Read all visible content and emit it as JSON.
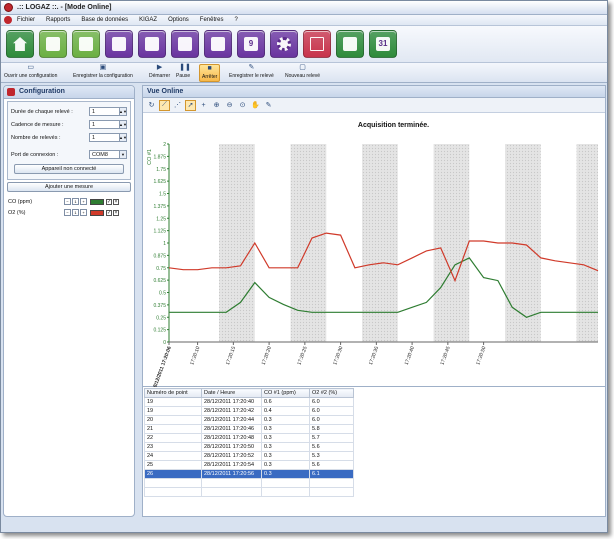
{
  "window": {
    "title": ".:: LOGAZ ::. - [Mode Online]"
  },
  "menu": [
    "Fichier",
    "Rapports",
    "Base de données",
    "KIGAZ",
    "Options",
    "Fenêtres",
    "?"
  ],
  "colors": {
    "bar_green": "#2e8b3b",
    "bar_purple": "#6a35a0",
    "series_co": "#2f7d32",
    "series_o2": "#d03a2a",
    "selected_row": "#3a6bc2"
  },
  "toolbar_big": [
    {
      "icon": "home-icon",
      "color": "#2e8b3b"
    },
    {
      "icon": "edit-sheet-icon",
      "color": "#6cb043"
    },
    {
      "icon": "sheet-add-icon",
      "color": "#6cb043"
    },
    {
      "icon": "chip-icon",
      "color": "#6a35a0"
    },
    {
      "icon": "user-icon",
      "color": "#6a35a0"
    },
    {
      "icon": "document-icon",
      "color": "#6a35a0"
    },
    {
      "icon": "folder-icon",
      "color": "#6a35a0"
    },
    {
      "icon": "calendar-icon",
      "color": "#6a35a0",
      "text": "9"
    },
    {
      "icon": "gear-icon",
      "color": "#6a35a0"
    },
    {
      "icon": "monitor-chart-icon",
      "color": "#c8344c"
    },
    {
      "icon": "export-icon",
      "color": "#2e8b3b"
    },
    {
      "icon": "calendar-31-icon",
      "color": "#2e8b3b",
      "text": "31"
    }
  ],
  "toolbar_small": [
    {
      "label": "Ouvrir une configuration",
      "icon": "open-icon"
    },
    {
      "label": "Enregistrer la configuration",
      "icon": "save-icon"
    },
    {
      "label": "Démarrer",
      "icon": "play-icon"
    },
    {
      "label": "Pause",
      "icon": "pause-icon"
    },
    {
      "label": "Arrêter",
      "icon": "stop-icon",
      "active": true
    },
    {
      "label": "Enregistrer le relevé",
      "icon": "save-record-icon"
    },
    {
      "label": "Nouveau relevé",
      "icon": "new-record-icon"
    }
  ],
  "config": {
    "title": "Configuration",
    "fields": [
      {
        "label": "Durée de chaque relevé :",
        "value": "1"
      },
      {
        "label": "Cadence de mesure :",
        "value": "1"
      },
      {
        "label": "Nombre de relevés :",
        "value": "1"
      }
    ],
    "port_label": "Port de connexion :",
    "port_value": "COM8",
    "device_button": "Appareil non connecté",
    "add_button": "Ajouter une mesure",
    "measures": [
      {
        "label": "CO (ppm)",
        "index": "1",
        "color": "#2f7d32"
      },
      {
        "label": "O2 (%)",
        "index": "1",
        "color": "#d03a2a"
      }
    ]
  },
  "vue": {
    "title": "Vue Online"
  },
  "chart_data": {
    "type": "line",
    "title": "Acquisition terminée.",
    "ylabel": "CO #1",
    "ylim": [
      0,
      2.0
    ],
    "yticks": [
      "0",
      "0.125",
      "0.25",
      "0.375",
      "0.5",
      "0.625",
      "0.75",
      "0.875",
      "1",
      "1.125",
      "1.25",
      "1.375",
      "1.5",
      "1.625",
      "1.75",
      "1.875",
      "2"
    ],
    "xlim": [
      0,
      60
    ],
    "xticks": [
      {
        "t": 0,
        "label": "28/12/2011 17:20:06"
      },
      {
        "t": 4,
        "label": "17:20:10"
      },
      {
        "t": 9,
        "label": "17:20:15"
      },
      {
        "t": 14,
        "label": "17:20:20"
      },
      {
        "t": 19,
        "label": "17:20:25"
      },
      {
        "t": 24,
        "label": "17:20:30"
      },
      {
        "t": 29,
        "label": "17:20:35"
      },
      {
        "t": 34,
        "label": "17:20:40"
      },
      {
        "t": 39,
        "label": "17:20:45"
      },
      {
        "t": 44,
        "label": "17:20:50"
      }
    ],
    "bands": [
      [
        7,
        12
      ],
      [
        17,
        22
      ],
      [
        27,
        32
      ],
      [
        37,
        42
      ],
      [
        47,
        52
      ],
      [
        57,
        60
      ]
    ],
    "series": [
      {
        "name": "CO #1 (ppm)",
        "color": "#2f7d32",
        "x": [
          0,
          2,
          4,
          6,
          8,
          10,
          12,
          14,
          16,
          18,
          20,
          22,
          24,
          26,
          28,
          30,
          32,
          34,
          36,
          38,
          40,
          42,
          44,
          46,
          48,
          50,
          52,
          54,
          56,
          58,
          60
        ],
        "y": [
          0.3,
          0.3,
          0.3,
          0.3,
          0.3,
          0.4,
          0.6,
          0.45,
          0.38,
          0.32,
          0.3,
          0.3,
          0.3,
          0.3,
          0.3,
          0.3,
          0.3,
          0.35,
          0.4,
          0.55,
          0.78,
          0.85,
          0.65,
          0.62,
          0.35,
          0.25,
          0.3,
          0.3,
          0.3,
          0.3,
          0.3
        ]
      },
      {
        "name": "O2 #2 (%)",
        "color": "#d03a2a",
        "x": [
          0,
          2,
          4,
          6,
          8,
          10,
          12,
          14,
          16,
          18,
          20,
          22,
          24,
          26,
          28,
          30,
          32,
          34,
          36,
          38,
          40,
          42,
          44,
          46,
          48,
          50,
          52,
          54,
          56,
          58,
          60
        ],
        "y": [
          0.75,
          0.73,
          0.73,
          0.75,
          0.75,
          0.77,
          1.0,
          0.75,
          0.75,
          0.75,
          1.05,
          1.1,
          1.08,
          0.75,
          0.78,
          0.8,
          0.78,
          0.85,
          0.92,
          0.95,
          0.62,
          1.02,
          1.02,
          1.0,
          1.0,
          0.98,
          0.85,
          0.82,
          0.8,
          0.78,
          0.72
        ]
      }
    ]
  },
  "table": {
    "headers": [
      "Numéro de point",
      "Date / Heure",
      "CO #1 (ppm)",
      "O2 #2 (%)"
    ],
    "rows": [
      [
        "19",
        "28/12/2011 17:20:40",
        "0.6",
        "6.0"
      ],
      [
        "19",
        "28/12/2011 17:20:42",
        "0.4",
        "6.0"
      ],
      [
        "20",
        "28/12/2011 17:20:44",
        "0.3",
        "6.0"
      ],
      [
        "21",
        "28/12/2011 17:20:46",
        "0.3",
        "5.8"
      ],
      [
        "22",
        "28/12/2011 17:20:48",
        "0.3",
        "5.7"
      ],
      [
        "23",
        "28/12/2011 17:20:50",
        "0.3",
        "5.6"
      ],
      [
        "24",
        "28/12/2011 17:20:52",
        "0.3",
        "5.3"
      ],
      [
        "25",
        "28/12/2011 17:20:54",
        "0.3",
        "5.6"
      ],
      [
        "26",
        "28/12/2011 17:20:56",
        "0.3",
        "6.1"
      ]
    ],
    "selected_index": 8
  }
}
